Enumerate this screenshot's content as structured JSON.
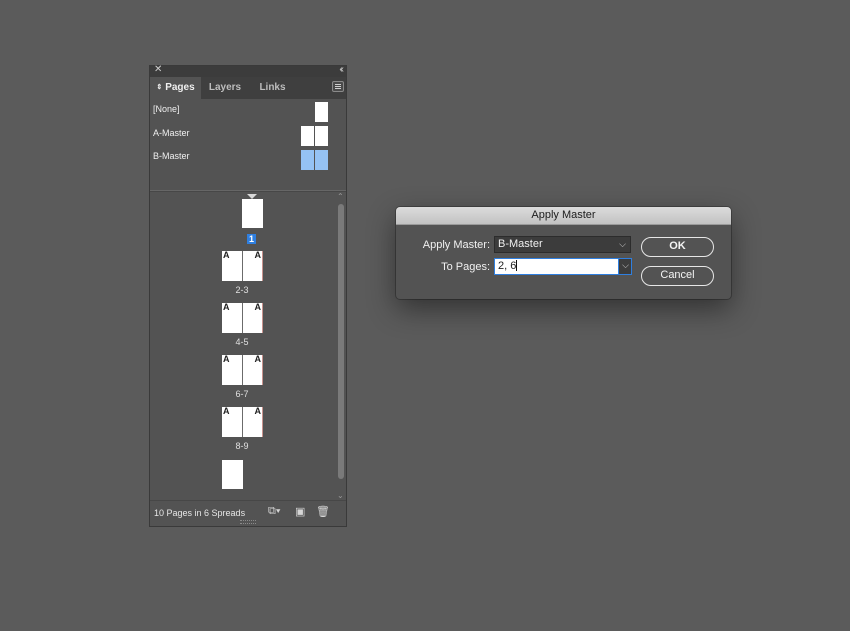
{
  "panel": {
    "tabs": [
      {
        "label": "Pages",
        "active": true
      },
      {
        "label": "Layers",
        "active": false
      },
      {
        "label": "Links",
        "active": false
      }
    ],
    "masters": [
      {
        "label": "[None]"
      },
      {
        "label": "A-Master"
      },
      {
        "label": "B-Master",
        "highlight_color": "#95c2f3"
      }
    ],
    "pages": {
      "first_page_label": "1",
      "spreads": [
        {
          "label": "2-3",
          "master_left": "A",
          "master_right": "A"
        },
        {
          "label": "4-5",
          "master_left": "A",
          "master_right": "A"
        },
        {
          "label": "6-7",
          "master_left": "A",
          "master_right": "A"
        },
        {
          "label": "8-9",
          "master_left": "A",
          "master_right": "A"
        }
      ]
    },
    "footer": {
      "status": "10 Pages in 6 Spreads",
      "icons": [
        "edit-page-size-icon",
        "new-page-icon",
        "trash-icon"
      ]
    }
  },
  "dialog": {
    "title": "Apply Master",
    "apply_master_label": "Apply Master:",
    "apply_master_value": "B-Master",
    "to_pages_label": "To Pages:",
    "to_pages_value": "2, 6",
    "ok_label": "OK",
    "cancel_label": "Cancel"
  },
  "colors": {
    "background": "#5b5b5b",
    "panel": "#535353",
    "selection_blue": "#2f7fe0"
  }
}
